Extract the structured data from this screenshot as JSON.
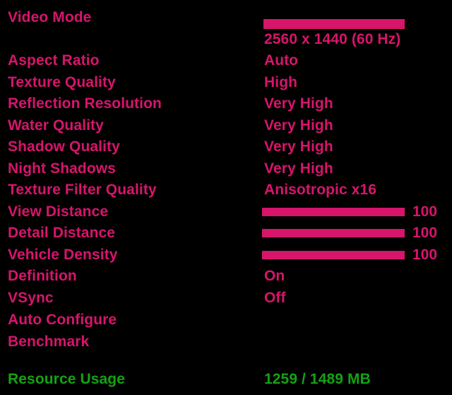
{
  "theme": {
    "background": "#000000",
    "accent_pink": "#d6156b",
    "accent_green": "#13a313"
  },
  "settings": {
    "video_mode": {
      "label": "Video Mode",
      "selector_bar": true,
      "value": "2560 x 1440 (60 Hz)"
    },
    "rows": [
      {
        "label": "Aspect Ratio",
        "value": "Auto"
      },
      {
        "label": "Texture Quality",
        "value": "High"
      },
      {
        "label": "Reflection Resolution",
        "value": "Very High"
      },
      {
        "label": "Water Quality",
        "value": "Very High"
      },
      {
        "label": "Shadow Quality",
        "value": "Very High"
      },
      {
        "label": "Night Shadows",
        "value": "Very High"
      },
      {
        "label": "Texture Filter Quality",
        "value": "Anisotropic x16"
      }
    ],
    "sliders": [
      {
        "label": "View Distance",
        "value": "100",
        "percent": 100
      },
      {
        "label": "Detail Distance",
        "value": "100",
        "percent": 100
      },
      {
        "label": "Vehicle Density",
        "value": "100",
        "percent": 100
      }
    ],
    "toggles": [
      {
        "label": "Definition",
        "value": "On"
      },
      {
        "label": "VSync",
        "value": "Off"
      }
    ],
    "actions": [
      {
        "label": "Auto Configure"
      },
      {
        "label": "Benchmark"
      }
    ]
  },
  "resource_usage": {
    "label": "Resource Usage",
    "value": "1259 / 1489 MB"
  }
}
